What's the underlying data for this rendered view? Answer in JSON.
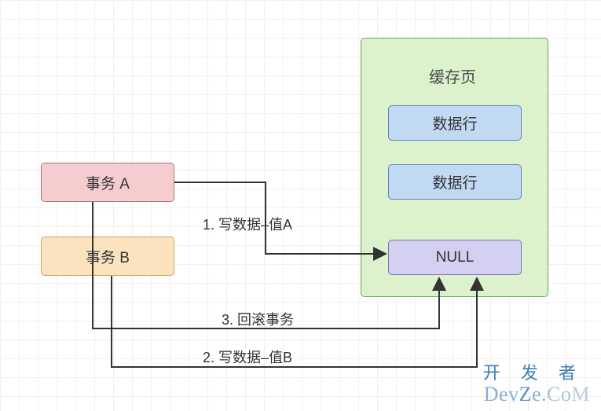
{
  "transactions": {
    "a": {
      "label": "事务 A",
      "bg": "#f6cdcf",
      "border": "#b07274"
    },
    "b": {
      "label": "事务 B",
      "bg": "#fbe3c0",
      "border": "#cba65f"
    }
  },
  "cache": {
    "title": "缓存页",
    "bg": "#dcf2cd",
    "border": "#6fa84f",
    "rows": [
      {
        "label": "数据行",
        "bg": "#c1d9f3",
        "border": "#5d87b8"
      },
      {
        "label": "数据行",
        "bg": "#c1d9f3",
        "border": "#5d87b8"
      },
      {
        "label": "NULL",
        "bg": "#d3d0f1",
        "border": "#7a74b8"
      }
    ]
  },
  "arrows": {
    "one": {
      "label": "1. 写数据–值A"
    },
    "two": {
      "label": "2. 写数据–值B"
    },
    "three": {
      "label": "3. 回滚事务"
    }
  },
  "watermark": {
    "line1": "开 发 者",
    "line2_parts": {
      "d": "Dev",
      "z": "Z",
      "e": "e.",
      "co": "Co",
      "m": "M"
    }
  }
}
